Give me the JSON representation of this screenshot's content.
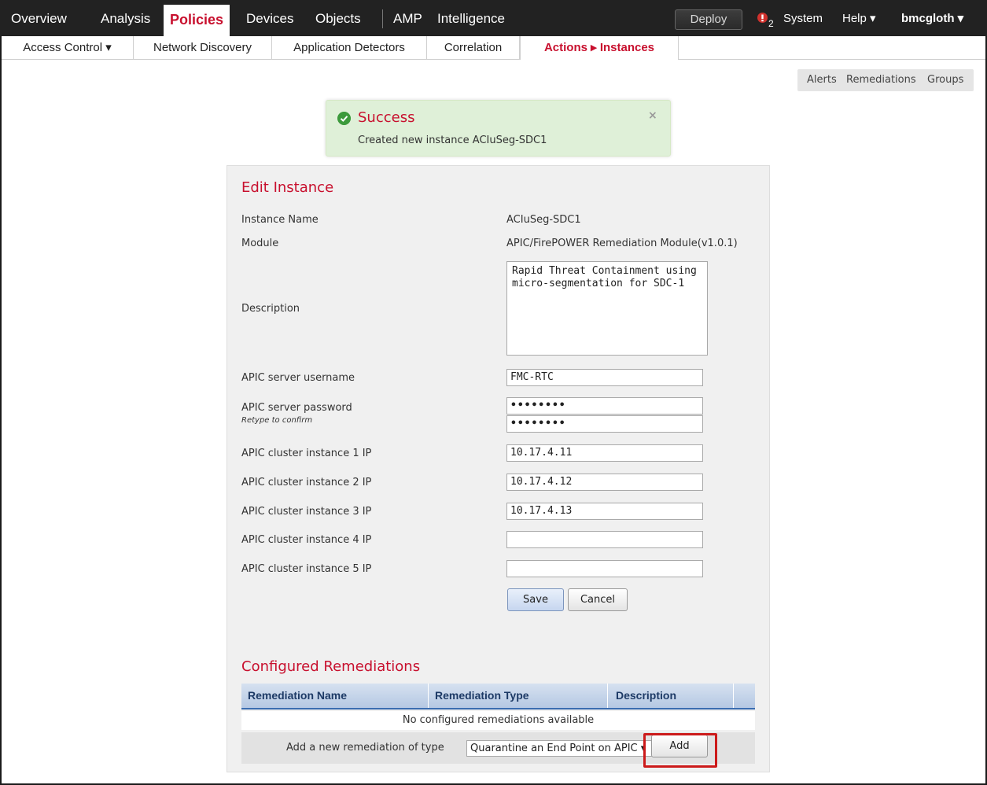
{
  "topnav": {
    "items": [
      "Overview",
      "Analysis",
      "Policies",
      "Devices",
      "Objects",
      "AMP",
      "Intelligence"
    ],
    "deploy_label": "Deploy",
    "alert_count": "2",
    "system_label": "System",
    "help_label": "Help ▾",
    "user_label": "bmcgloth ▾"
  },
  "subnav": {
    "items": [
      "Access Control ▾",
      "Network Discovery",
      "Application Detectors",
      "Correlation",
      "Actions ▸ Instances"
    ]
  },
  "right_tabs": [
    "Alerts",
    "Remediations",
    "Groups"
  ],
  "success": {
    "title": "Success",
    "message": "Created new instance ACIuSeg-SDC1",
    "close": "×"
  },
  "edit": {
    "title": "Edit Instance",
    "instance_name_label": "Instance Name",
    "instance_name_value": "ACIuSeg-SDC1",
    "module_label": "Module",
    "module_value": "APIC/FirePOWER Remediation Module(v1.0.1)",
    "description_label": "Description",
    "description_value": "Rapid Threat Containment using\nmicro-segmentation for SDC-1",
    "username_label": "APIC server username",
    "username_value": "FMC-RTC",
    "password_label": "APIC server password",
    "retype_label": "Retype to confirm",
    "password_value": "••••••••",
    "retype_value": "••••••••",
    "ip1_label": "APIC cluster instance 1 IP",
    "ip1_value": "10.17.4.11",
    "ip2_label": "APIC cluster instance 2 IP",
    "ip2_value": "10.17.4.12",
    "ip3_label": "APIC cluster instance 3 IP",
    "ip3_value": "10.17.4.13",
    "ip4_label": "APIC cluster instance 4 IP",
    "ip4_value": "",
    "ip5_label": "APIC cluster instance 5 IP",
    "ip5_value": "",
    "save_label": "Save",
    "cancel_label": "Cancel"
  },
  "remediations": {
    "title": "Configured Remediations",
    "columns": [
      "Remediation Name",
      "Remediation Type",
      "Description"
    ],
    "empty_text": "No configured remediations available",
    "add_prompt": "Add a new remediation of type",
    "type_selected": "Quarantine an End Point on APIC ▾",
    "add_label": "Add"
  },
  "colors": {
    "accent_red": "#c8102e",
    "nav_bg": "#222222",
    "success_bg": "#dff0d8",
    "highlight_box": "#cc1a1a"
  }
}
